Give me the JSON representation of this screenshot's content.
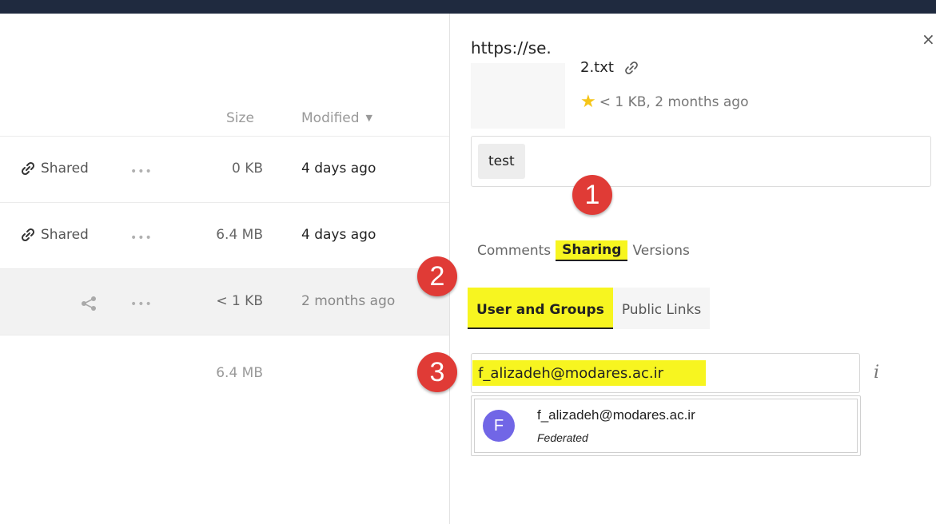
{
  "file_list": {
    "headers": {
      "size": "Size",
      "modified": "Modified"
    },
    "rows": [
      {
        "share_label": "Shared",
        "size": "0 KB",
        "modified": "4 days ago"
      },
      {
        "share_label": "Shared",
        "size": "6.4 MB",
        "modified": "4 days ago"
      },
      {
        "share_label": "",
        "size": "< 1 KB",
        "modified": "2 months ago"
      }
    ],
    "total_size": "6.4 MB",
    "dots": "•••"
  },
  "sidebar": {
    "close": "×",
    "url_text": "https://se.",
    "filename": "2.txt",
    "meta": "< 1 KB, 2 months ago",
    "tag": "test",
    "tabs": [
      "Comments",
      "Sharing",
      "Versions"
    ],
    "active_tab": "Sharing",
    "subtabs": [
      "User and Groups",
      "Public Links"
    ],
    "active_subtab": "User and Groups",
    "share_input_value": "f_alizadeh@modares.ac.ir",
    "info_icon": "i",
    "suggestion": {
      "avatar_letter": "F",
      "email": "f_alizadeh@modares.ac.ir",
      "type": "Federated"
    }
  },
  "annotations": {
    "step1": "1",
    "step2": "2",
    "step3": "3"
  },
  "colors": {
    "highlight": "#f7f520",
    "badge": "#e03b36",
    "avatar": "#7166e6",
    "topbar": "#1f2a3f"
  }
}
